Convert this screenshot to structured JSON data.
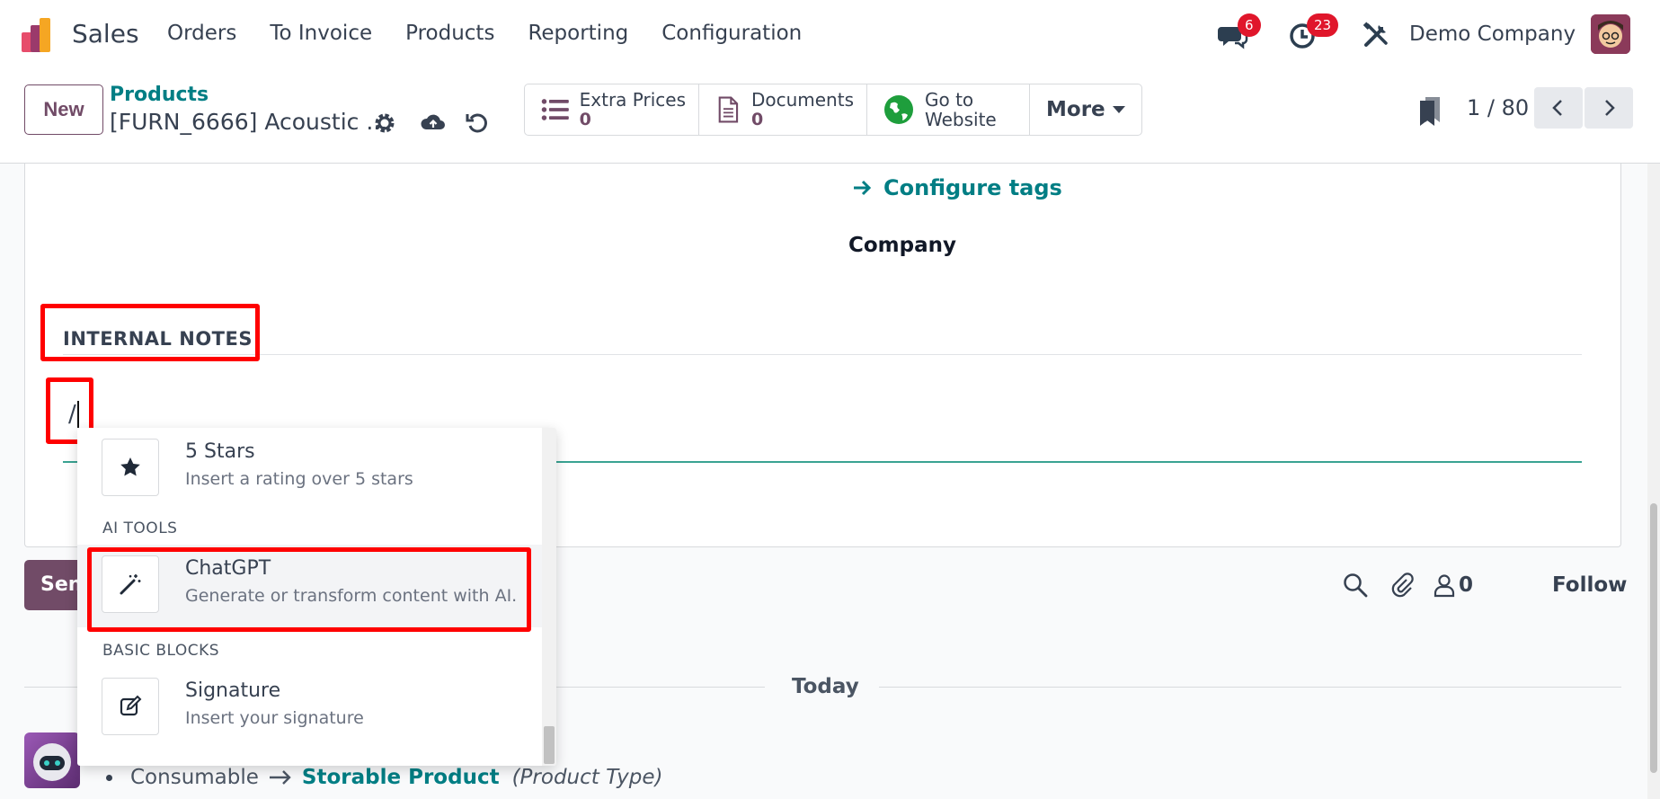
{
  "navbar": {
    "app_name": "Sales",
    "menu": [
      "Orders",
      "To Invoice",
      "Products",
      "Reporting",
      "Configuration"
    ],
    "messages_badge": "6",
    "activities_badge": "23",
    "company": "Demo Company"
  },
  "control_panel": {
    "new_label": "New",
    "breadcrumb": "Products",
    "record_title": "[FURN_6666] Acoustic ...",
    "stat_buttons": [
      {
        "label": "Extra Prices",
        "value": "0"
      },
      {
        "label": "Documents",
        "value": "0"
      },
      {
        "label": "Go to Website",
        "line1": "Go to",
        "line2": "Website"
      }
    ],
    "more_label": "More",
    "pager": "1 / 80"
  },
  "form": {
    "configure_tags": "Configure tags",
    "company_label": "Company",
    "internal_notes_header": "INTERNAL NOTES",
    "editor_value": "/"
  },
  "powerbox": {
    "items": [
      {
        "title": "5 Stars",
        "description": "Insert a rating over 5 stars",
        "icon": "star-icon"
      },
      {
        "category": "AI TOOLS"
      },
      {
        "title": "ChatGPT",
        "description": "Generate or transform content with AI.",
        "icon": "magic-wand-icon"
      },
      {
        "category": "BASIC BLOCKS"
      },
      {
        "title": "Signature",
        "description": "Insert your signature",
        "icon": "signature-icon"
      }
    ]
  },
  "chatter": {
    "send_label": "Sen",
    "followers_count": "0",
    "follow_label": "Follow",
    "date_separator": "Today",
    "tracking": {
      "old_value": "Consumable",
      "new_value": "Storable Product",
      "field": "(Product Type)"
    }
  },
  "colors": {
    "brand": "#714b67",
    "link": "#017e84",
    "highlight": "#ff0000",
    "badge": "#e0162b"
  }
}
